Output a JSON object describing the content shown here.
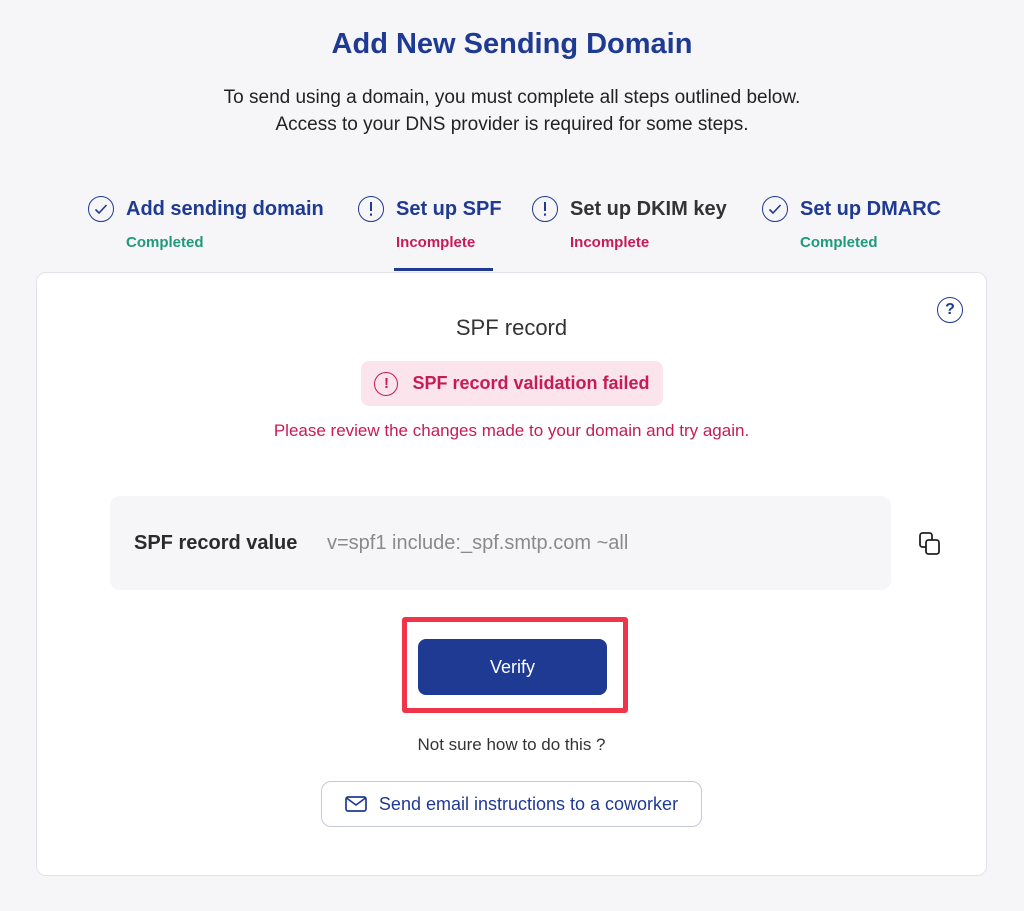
{
  "header": {
    "title": "Add New Sending Domain",
    "subtitle_line1": "To send using a domain, you must complete all steps outlined below.",
    "subtitle_line2": "Access to your DNS provider is required for some steps."
  },
  "steps": [
    {
      "label": "Add sending domain",
      "status": "Completed",
      "icon": "check-icon"
    },
    {
      "label": "Set up SPF",
      "status": "Incomplete",
      "icon": "exclamation-icon"
    },
    {
      "label": "Set up DKIM key",
      "status": "Incomplete",
      "icon": "exclamation-icon"
    },
    {
      "label": "Set up DMARC",
      "status": "Completed",
      "icon": "check-icon"
    }
  ],
  "card": {
    "title": "SPF record",
    "error_badge": "SPF record validation failed",
    "error_message": "Please review the changes made to your domain and try again.",
    "record_label": "SPF record value",
    "record_value": "v=spf1 include:_spf.smtp.com ~all",
    "verify_label": "Verify",
    "help_text": "Not sure how to do this ?",
    "send_label": "Send email instructions to a coworker"
  },
  "colors": {
    "brand": "#1f3a93",
    "error": "#c81a57",
    "success": "#1e9a7a",
    "highlight": "#f0344a"
  }
}
